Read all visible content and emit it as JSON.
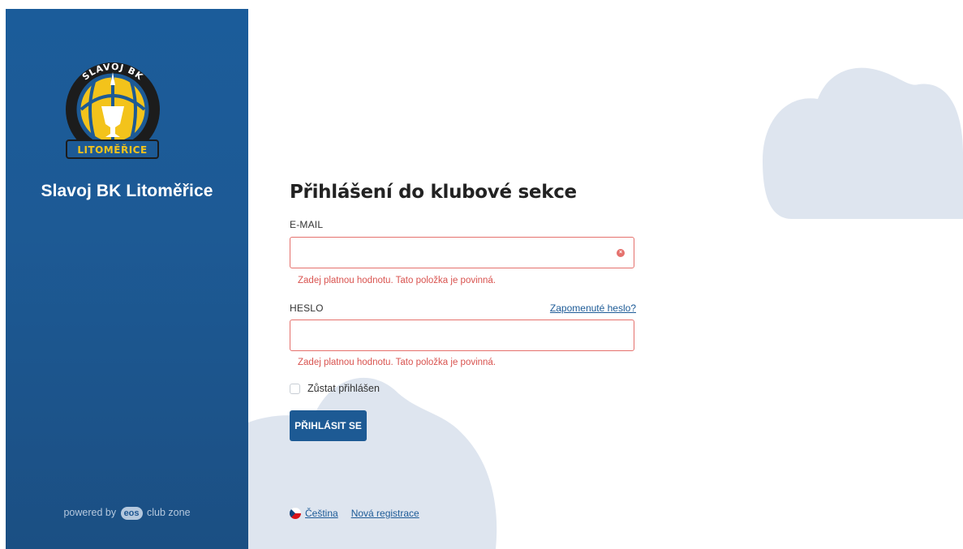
{
  "sidebar": {
    "logo": {
      "top_text": "SLAVOJ BK",
      "bottom_text": "LITOMĚŘICE"
    },
    "club_name": "Slavoj BK Litoměřice",
    "powered_prefix": "powered by",
    "powered_logo": "eos",
    "powered_suffix": "club zone"
  },
  "form": {
    "title": "Přihlášení do klubové sekce",
    "email": {
      "label": "E-MAIL",
      "value": "",
      "placeholder": "",
      "error": "Zadej platnou hodnotu. Tato položka je povinná."
    },
    "password": {
      "label": "HESLO",
      "value": "",
      "placeholder": "",
      "error": "Zadej platnou hodnotu. Tato položka je povinná.",
      "forgot_link": "Zapomenuté heslo?"
    },
    "remember_label": "Zůstat přihlášen",
    "submit_label": "PŘIHLÁSIT SE"
  },
  "footer": {
    "language_label": "Čeština",
    "register_label": "Nová registrace"
  },
  "colors": {
    "sidebar": "#1d5a95",
    "primary_button": "#1d5a94",
    "error": "#d9534f",
    "cloud": "#dee5ef",
    "link": "#1d5b97"
  },
  "icons": {
    "clear": "clear-icon",
    "flag": "czech-flag-icon"
  }
}
